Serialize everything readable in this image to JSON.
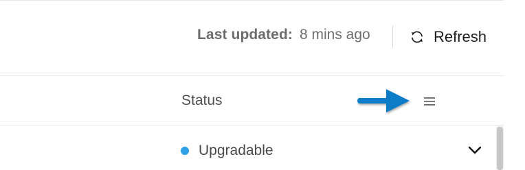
{
  "toolbar": {
    "last_updated_label": "Last updated:",
    "last_updated_value": "8 mins ago",
    "refresh_label": "Refresh",
    "refresh_icon": "refresh-icon"
  },
  "table": {
    "header": {
      "status_label": "Status",
      "menu_icon": "hamburger-menu-icon"
    },
    "rows": [
      {
        "status": "Upgradable",
        "status_color": "#2f9fe8",
        "expand_icon": "chevron-down-icon"
      }
    ]
  },
  "annotation": {
    "arrow_color": "#0f7cc7"
  }
}
